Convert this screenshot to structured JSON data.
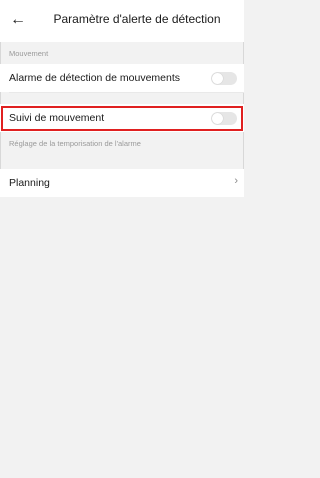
{
  "header": {
    "back_icon": "arrow-left-icon",
    "title": "Paramètre d'alerte de détection"
  },
  "sections": {
    "movement_label": "Mouvement",
    "timing_label": "Réglage de la temporisation de l'alarme"
  },
  "rows": {
    "motion_alarm": {
      "label": "Alarme de détection de mouvements",
      "enabled": false
    },
    "motion_tracking": {
      "label": "Suivi de mouvement",
      "enabled": false
    },
    "planning": {
      "label": "Planning",
      "chevron_icon": "chevron-right-icon"
    }
  },
  "colors": {
    "highlight": "#e02020",
    "toggle_off": "#e6e6e6",
    "background": "#f2f2f2"
  }
}
